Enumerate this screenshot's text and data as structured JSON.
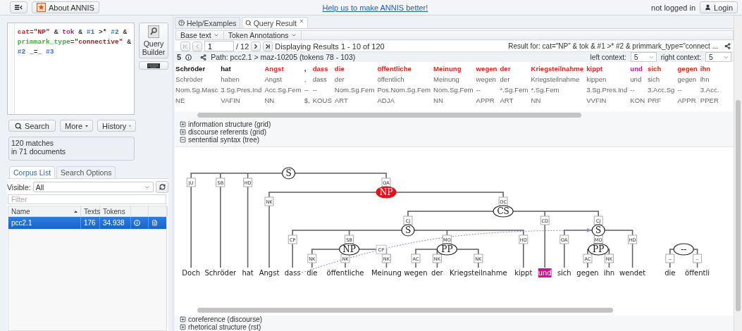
{
  "top_bar": {
    "about_button": "About ANNIS",
    "feedback_link": "Help us to make ANNIS better!",
    "login_status": "not logged in",
    "login_button": "Login"
  },
  "query_editor": {
    "lines": [
      [
        {
          "text": "cat",
          "color": "#e8231f"
        },
        {
          "text": "=\"NP\"",
          "color": "#a31f1f"
        },
        {
          "text": " & "
        },
        {
          "text": "tok",
          "color": "#c2188b"
        },
        {
          "text": " & "
        },
        {
          "text": "#1",
          "color": "#2f6fd6"
        },
        {
          "text": " >* "
        },
        {
          "text": "#2",
          "color": "#2f6fd6"
        },
        {
          "text": " &"
        }
      ],
      [
        {
          "text": "primmark_type",
          "color": "#3cb43c"
        },
        {
          "text": "=\"connective\"",
          "color": "#a31f1f"
        },
        {
          "text": " &"
        }
      ],
      [
        {
          "text": "#2",
          "color": "#2f6fd6"
        },
        {
          "text": " _=_ "
        },
        {
          "text": "#3",
          "color": "#2f6fd6"
        }
      ]
    ]
  },
  "query_builder_button": "Query Builder",
  "actions": [
    {
      "label": "Search",
      "kind": "search"
    },
    {
      "label": "More",
      "kind": "menu"
    },
    {
      "label": "History",
      "kind": "menu"
    }
  ],
  "status": [
    "120 matches",
    "in 71 documents"
  ],
  "left_tabs": [
    {
      "label": "Corpus List",
      "selected": true
    },
    {
      "label": "Search Options",
      "selected": false
    }
  ],
  "visible": {
    "label": "Visible:",
    "value": "All"
  },
  "filter": {
    "placeholder": "Filter"
  },
  "corpus_table": {
    "columns": [
      "Name",
      "Texts",
      "Tokens"
    ],
    "rows": [
      {
        "name": "pcc2.1",
        "texts": "176",
        "tokens": "34.938",
        "selected": true
      }
    ]
  },
  "result_tabs": [
    {
      "label": "Help/Examples",
      "kind": "help",
      "selected": false,
      "closable": false
    },
    {
      "label": "Query Result",
      "kind": "search",
      "selected": true,
      "closable": true
    }
  ],
  "view_menus": [
    "Base text",
    "Token Annotations"
  ],
  "pager": {
    "page": "1",
    "total": "/ 12",
    "summary": "Displaying Results 1 - 10 of 120",
    "result_for": "Result for: cat=\"NP\" & tok & #1 >* #2 & primmark_type=\"connect ..."
  },
  "match": {
    "number": "5",
    "path": "Path: pcc2.1 > maz-10205 (tokens 78 - 103)",
    "left_context_label": "left context:",
    "left_context": "5",
    "right_context_label": "right context:",
    "right_context": "5"
  },
  "kwic": [
    {
      "cells": [
        "Schröder",
        "Schröder",
        "Nom.Sg.Masc",
        "NE"
      ]
    },
    {
      "cells": [
        "hat",
        "haben",
        "3.Sg.Pres.Ind",
        "VAFIN"
      ]
    },
    {
      "cells": [
        "Angst",
        "Angst",
        "Acc.Sg.Fem",
        "NN"
      ],
      "color": "#e8231f"
    },
    {
      "cells": [
        ",",
        ",",
        "--",
        "$,"
      ]
    },
    {
      "cells": [
        "dass",
        "dass",
        "--",
        "KOUS"
      ],
      "color": "#e8231f"
    },
    {
      "cells": [
        "die",
        "der",
        "Nom.Sg.Fem",
        "ART"
      ],
      "color": "#e8231f"
    },
    {
      "cells": [
        "öffentliche",
        "öffentlich",
        "Pos.Nom.Sg.Fem",
        "ADJA"
      ],
      "color": "#e8231f"
    },
    {
      "cells": [
        "Meinung",
        "Meinung",
        "Nom.Sg.Fem",
        "NN"
      ],
      "color": "#e8231f"
    },
    {
      "cells": [
        "wegen",
        "wegen",
        "--",
        "APPR"
      ],
      "color": "#e8231f"
    },
    {
      "cells": [
        "der",
        "der",
        "*.Sg.Fem",
        "ART"
      ],
      "color": "#e8231f"
    },
    {
      "cells": [
        "Kriegsteilnahme",
        "Kriegsteilnahme",
        "*.Sg.Fem",
        "NN"
      ],
      "color": "#e8231f"
    },
    {
      "cells": [
        "kippt",
        "kippen",
        "3.Sg.Pres.Ind",
        "VVFIN"
      ],
      "color": "#e8231f"
    },
    {
      "cells": [
        "und",
        "und",
        "--",
        "KON"
      ],
      "color": "#c2188b"
    },
    {
      "cells": [
        "sich",
        "sich",
        "3.Acc.Sg",
        "PRF"
      ],
      "color": "#e8231f"
    },
    {
      "cells": [
        "gegen",
        "gegen",
        "--",
        "APPR"
      ],
      "color": "#e8231f"
    },
    {
      "cells": [
        "ihn",
        "ihn",
        "3.Acc.",
        "PPER"
      ],
      "color": "#e8231f"
    }
  ],
  "layers": [
    {
      "label": "information structure (grid)",
      "expanded": false
    },
    {
      "label": "discourse referents (grid)",
      "expanded": false
    },
    {
      "label": "sentential syntax (tree)",
      "expanded": true,
      "trees": [
        {
          "label": "S",
          "match": false,
          "children": [
            {
              "edge": "JU",
              "token": "Doch",
              "match": false
            },
            {
              "edge": "SB",
              "token": "Schröder",
              "match": false
            },
            {
              "edge": "HD",
              "token": "hat",
              "match": false
            },
            {
              "edge": "OA",
              "label": "NP",
              "match": true,
              "children": [
                {
                  "edge": "NK",
                  "token": "Angst",
                  "match": false
                },
                {
                  "edge": "OC",
                  "label": "CS",
                  "match": false,
                  "children": [
                    {
                      "edge": "CJ",
                      "label": "S",
                      "match": false,
                      "children": [
                        {
                          "edge": "CP",
                          "token": "dass",
                          "match": false,
                          "pointing_label": "CP"
                        },
                        {
                          "edge": "SB",
                          "label": "NP",
                          "match": false,
                          "children": [
                            {
                              "edge": "NK",
                              "token": "die",
                              "match": false
                            },
                            {
                              "edge": "NK",
                              "token": "öffentliche",
                              "match": false
                            },
                            {
                              "edge": "NK",
                              "token": "Meinung",
                              "match": false
                            }
                          ]
                        },
                        {
                          "edge": "MO",
                          "label": "PP",
                          "match": false,
                          "children": [
                            {
                              "edge": "AC",
                              "token": "wegen",
                              "match": false
                            },
                            {
                              "edge": "NK",
                              "token": "der",
                              "match": false
                            },
                            {
                              "edge": "NK",
                              "token": "Kriegsteilnahme",
                              "match": false
                            }
                          ]
                        },
                        {
                          "edge": "HD",
                          "token": "kippt",
                          "match": false
                        }
                      ]
                    },
                    {
                      "edge": "CD",
                      "token": "und",
                      "match": true
                    },
                    {
                      "edge": "CJ",
                      "label": "S",
                      "match": false,
                      "pointing_target": true,
                      "children": [
                        {
                          "edge": "OA",
                          "token": "sich",
                          "match": false
                        },
                        {
                          "edge": "MO",
                          "label": "PP",
                          "match": false,
                          "children": [
                            {
                              "edge": "AC",
                              "token": "gegen",
                              "match": false
                            },
                            {
                              "edge": "NK",
                              "token": "ihn",
                              "match": false
                            }
                          ]
                        },
                        {
                          "edge": "HD",
                          "token": "wendet",
                          "match": false
                        }
                      ]
                    }
                  ]
                }
              ]
            }
          ]
        },
        {
          "label": "--",
          "match": false,
          "children": [
            {
              "edge": "--",
              "token": "die",
              "match": false
            },
            {
              "edge": "--",
              "token": "öffentli",
              "match": false
            }
          ]
        }
      ]
    },
    {
      "label": "coreference (discourse)",
      "expanded": false
    },
    {
      "label": "rhetorical structure (rst)",
      "expanded": false
    }
  ]
}
